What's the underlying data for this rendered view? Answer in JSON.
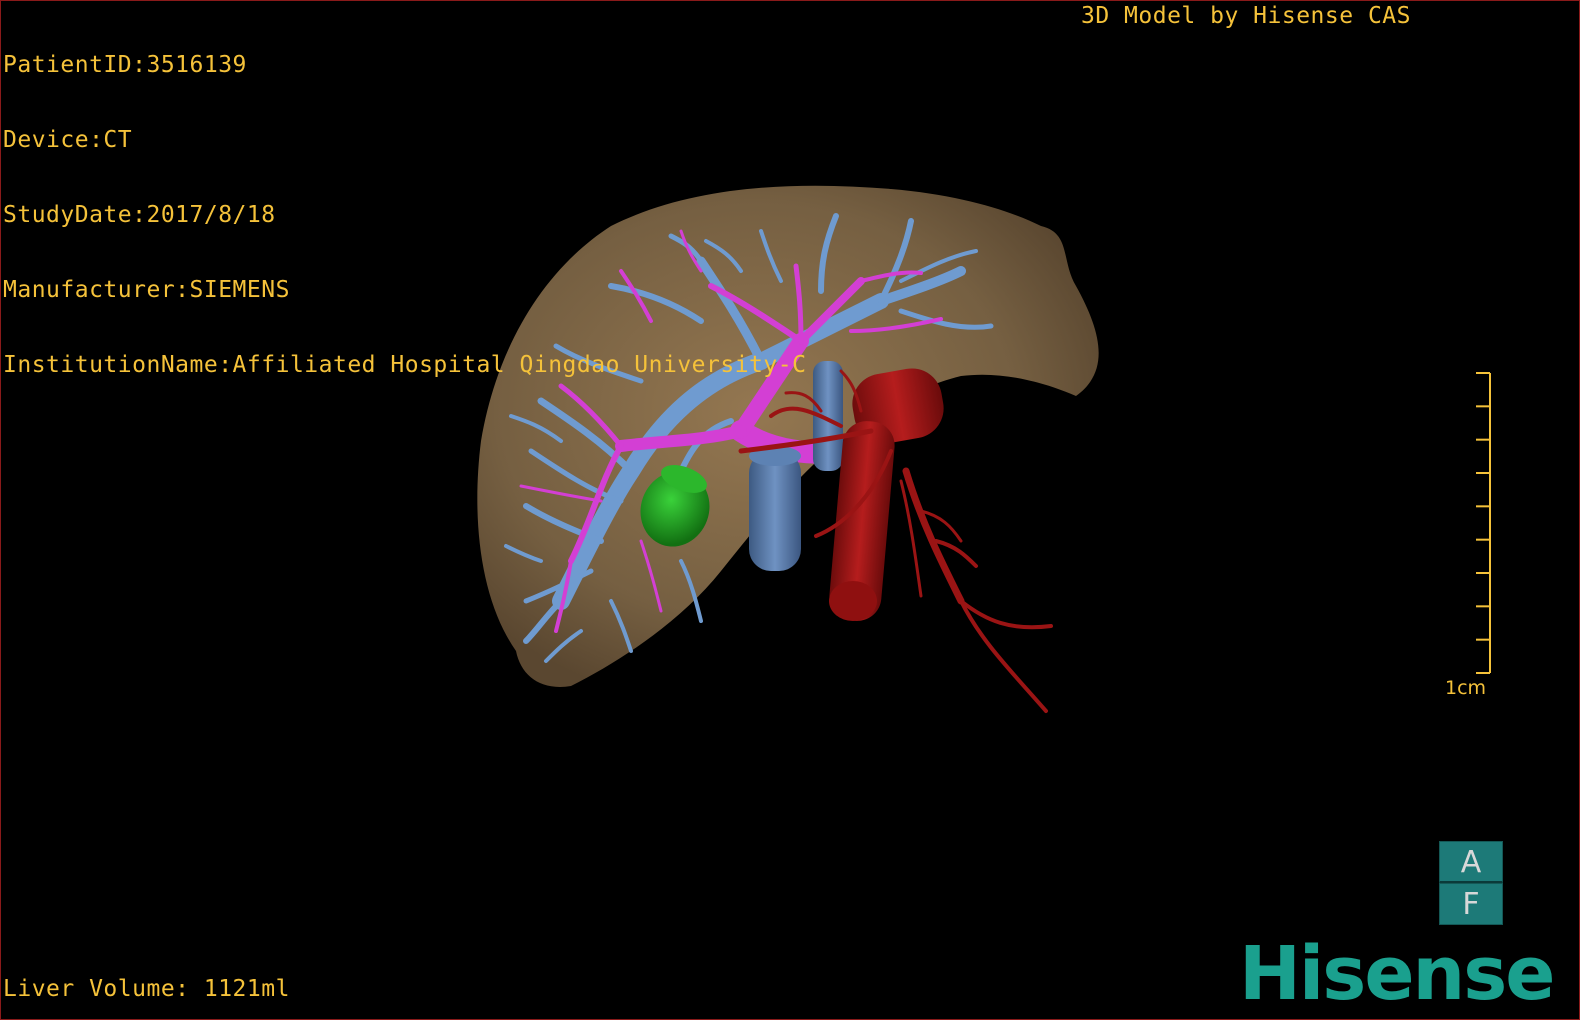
{
  "patient_info": {
    "patient_id": "PatientID:3516139",
    "device": "Device:CT",
    "study_date": "StudyDate:2017/8/18",
    "manufacturer": "Manufacturer:SIEMENS",
    "institution": "InstitutionName:Affiliated Hospital Qingdao University-C"
  },
  "credit": "3D Model by Hisense CAS",
  "liver_volume": "Liver Volume: 1121ml",
  "scale": {
    "label": "1cm",
    "tick_count": 10
  },
  "orientation": {
    "top_face": "A",
    "bottom_face": "F"
  },
  "brand_logo": "Hisense",
  "colors": {
    "overlay_text": "#f5c23a",
    "liver": "#7a6344",
    "portal_vein": "#d33fd4",
    "hepatic_vein": "#6f9bd0",
    "vena_cava": "#50729f",
    "artery": "#9a1414",
    "tumor": "#1d9a1d",
    "logo": "#1aa08e"
  }
}
